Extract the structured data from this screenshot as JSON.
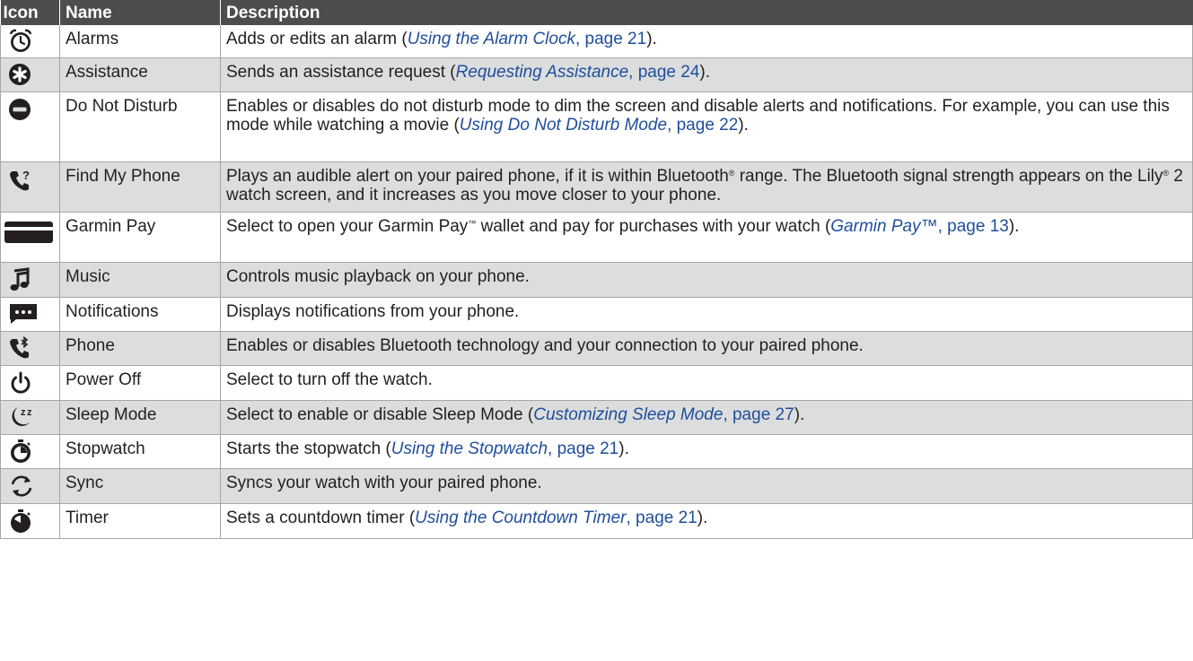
{
  "table": {
    "headers": {
      "icon": "Icon",
      "name": "Name",
      "description": "Description"
    },
    "rows": [
      {
        "icon": "alarm-clock-icon",
        "name": "Alarms",
        "desc_before": "Adds or edits an alarm (",
        "link_title": "Using the Alarm Clock",
        "link_page": ", page 21",
        "desc_after": ")."
      },
      {
        "icon": "assistance-icon",
        "name": "Assistance",
        "desc_before": "Sends an assistance request (",
        "link_title": "Requesting Assistance",
        "link_page": ", page 24",
        "desc_after": ")."
      },
      {
        "icon": "do-not-disturb-icon",
        "name": "Do Not Disturb",
        "desc_before": "Enables or disables do not disturb mode to dim the screen and disable alerts and notifications. For example, you can use this mode while watching a movie (",
        "link_title": "Using Do Not Disturb Mode",
        "link_page": ", page 22",
        "desc_after": ")."
      },
      {
        "icon": "find-phone-icon",
        "name": "Find My Phone",
        "desc_p1": "Plays an audible alert on your paired phone, if it is within Bluetooth",
        "reg1": "®",
        "desc_p2": " range. The Bluetooth signal strength appears on the Lily",
        "reg2": "®",
        "desc_p3": " 2 watch screen, and it increases as you move closer to your phone."
      },
      {
        "icon": "wallet-card-icon",
        "name": "Garmin Pay",
        "desc_p1": "Select to open your Garmin Pay",
        "tm": "™",
        "desc_p2": " wallet and pay for purchases with your watch (",
        "link_title": "Garmin Pay™",
        "link_page": ", page 13",
        "desc_after": ")."
      },
      {
        "icon": "music-note-icon",
        "name": "Music",
        "desc": "Controls music playback on your phone."
      },
      {
        "icon": "notifications-icon",
        "name": "Notifications",
        "desc": "Displays notifications from your phone."
      },
      {
        "icon": "phone-bluetooth-icon",
        "name": "Phone",
        "desc": "Enables or disables Bluetooth technology and your connection to your paired phone."
      },
      {
        "icon": "power-icon",
        "name": "Power Off",
        "desc": "Select to turn off the watch."
      },
      {
        "icon": "sleep-mode-icon",
        "name": "Sleep Mode",
        "desc_before": "Select to enable or disable Sleep Mode (",
        "link_title": "Customizing Sleep Mode",
        "link_page": ", page 27",
        "desc_after": ")."
      },
      {
        "icon": "stopwatch-icon",
        "name": "Stopwatch",
        "desc_before": "Starts the stopwatch (",
        "link_title": "Using the Stopwatch",
        "link_page": ", page 21",
        "desc_after": ")."
      },
      {
        "icon": "sync-icon",
        "name": "Sync",
        "desc": "Syncs your watch with your paired phone."
      },
      {
        "icon": "timer-icon",
        "name": "Timer",
        "desc_before": "Sets a countdown timer (",
        "link_title": "Using the Countdown Timer",
        "link_page": ", page 21",
        "desc_after": ")."
      }
    ]
  }
}
